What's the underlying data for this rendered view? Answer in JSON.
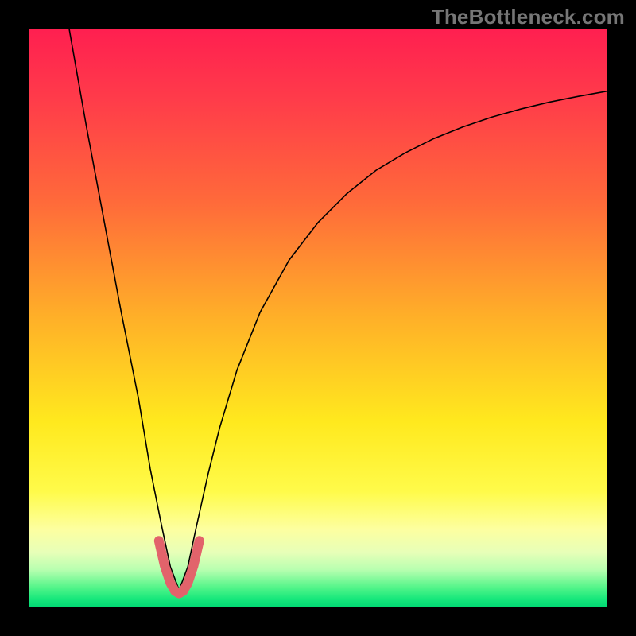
{
  "watermark": "TheBottleneck.com",
  "chart_data": {
    "type": "line",
    "title": "",
    "xlabel": "",
    "ylabel": "",
    "xlim": [
      0,
      100
    ],
    "ylim": [
      0,
      100
    ],
    "optimum_x": 26,
    "series": [
      {
        "name": "bottleneck-curve",
        "color": "#000000",
        "width": 1.6,
        "x": [
          7,
          10,
          13,
          16,
          19,
          21,
          23,
          24.5,
          26,
          27.5,
          29,
          31,
          33,
          36,
          40,
          45,
          50,
          55,
          60,
          65,
          70,
          75,
          80,
          85,
          90,
          95,
          100
        ],
        "y": [
          100,
          83,
          67,
          51,
          36,
          24,
          14,
          7,
          3,
          7,
          14,
          23,
          31,
          41,
          51,
          60,
          66.5,
          71.5,
          75.5,
          78.5,
          81,
          83,
          84.7,
          86.1,
          87.3,
          88.3,
          89.2
        ]
      },
      {
        "name": "optimum-band",
        "color": "#e2636b",
        "width": 12,
        "linecap": "round",
        "x": [
          22.5,
          23.5,
          24.5,
          25.3,
          26,
          26.7,
          27.5,
          28.5,
          29.5
        ],
        "y": [
          11.5,
          7.2,
          4.2,
          2.8,
          2.4,
          2.8,
          4.2,
          7.2,
          11.5
        ]
      }
    ],
    "background_gradient": {
      "stops": [
        {
          "offset": 0.0,
          "color": "#ff1f50"
        },
        {
          "offset": 0.12,
          "color": "#ff3b4a"
        },
        {
          "offset": 0.3,
          "color": "#ff6a3a"
        },
        {
          "offset": 0.5,
          "color": "#ffb028"
        },
        {
          "offset": 0.68,
          "color": "#ffe91e"
        },
        {
          "offset": 0.8,
          "color": "#fffb4a"
        },
        {
          "offset": 0.865,
          "color": "#fdffa0"
        },
        {
          "offset": 0.905,
          "color": "#e7ffb8"
        },
        {
          "offset": 0.935,
          "color": "#b8ffb0"
        },
        {
          "offset": 0.965,
          "color": "#55f58a"
        },
        {
          "offset": 0.985,
          "color": "#18e87c"
        },
        {
          "offset": 1.0,
          "color": "#00d873"
        }
      ]
    }
  }
}
